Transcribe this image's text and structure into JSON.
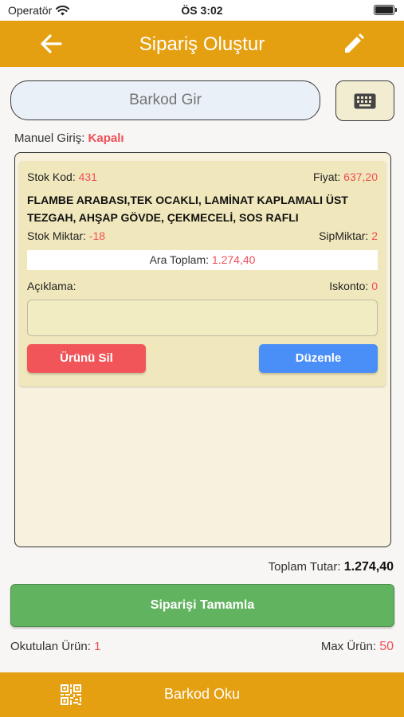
{
  "status_bar": {
    "carrier": "Operatör",
    "time": "ÖS 3:02"
  },
  "header": {
    "title": "Sipariş Oluştur",
    "back_icon": "arrow-left-icon",
    "edit_icon": "pencil-icon"
  },
  "barcode": {
    "placeholder": "Barkod Gir"
  },
  "manual_entry": {
    "label": "Manuel Giriş:",
    "value": "Kapalı"
  },
  "items": [
    {
      "stock_code_label": "Stok Kod:",
      "stock_code": "431",
      "price_label": "Fiyat:",
      "price": "637,20",
      "name": "FLAMBE ARABASI,TEK OCAKLI, LAMİNAT KAPLAMALI ÜST TEZGAH, AHŞAP GÖVDE, ÇEKMECELİ, SOS RAFLI",
      "stock_qty_label": "Stok Miktar:",
      "stock_qty": "-18",
      "order_qty_label": "SipMiktar:",
      "order_qty": "2",
      "subtotal_label": "Ara Toplam:",
      "subtotal": "1.274,40",
      "description_label": "Açıklama:",
      "discount_label": "Iskonto:",
      "discount": "0",
      "delete_label": "Ürünü Sil",
      "edit_label": "Düzenle"
    }
  ],
  "total": {
    "label": "Toplam Tutar:",
    "value": "1.274,40"
  },
  "complete_label": "Siparişi Tamamla",
  "counts": {
    "read_label": "Okutulan Ürün:",
    "read_value": "1",
    "max_label": "Max Ürün:",
    "max_value": "50"
  },
  "bottom_bar": {
    "label": "Barkod Oku",
    "icon": "qr-code-icon"
  },
  "colors": {
    "accent": "#e5a012",
    "danger": "#f1555a",
    "primary": "#4a8ef8",
    "success": "#62b35f",
    "highlight": "#f04e57"
  }
}
